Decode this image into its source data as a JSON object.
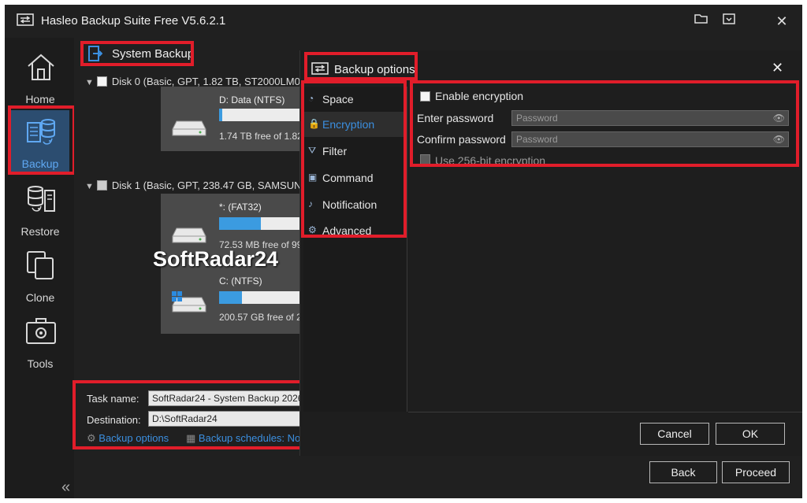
{
  "app": {
    "title": "Hasleo Backup Suite Free V5.6.2.1"
  },
  "titlebar": {
    "folder_icon": "folder-open-icon",
    "menu_icon": "menu-icon",
    "close": "✕"
  },
  "sidenav": {
    "items": [
      {
        "label": "Home",
        "icon": "home-icon"
      },
      {
        "label": "Backup",
        "icon": "backup-icon",
        "active": true
      },
      {
        "label": "Restore",
        "icon": "restore-icon"
      },
      {
        "label": "Clone",
        "icon": "clone-icon"
      },
      {
        "label": "Tools",
        "icon": "tools-icon"
      }
    ],
    "collapse": "«"
  },
  "main": {
    "title": "System Backup",
    "disks": [
      {
        "label": "Disk 0 (Basic, GPT, 1.82 TB,  ST2000LM0",
        "partitions": [
          {
            "name": "D: Data (NTFS)",
            "free": "1.74 TB free of 1.82",
            "used_fraction": 0.04
          }
        ]
      },
      {
        "label": "Disk 1 (Basic, GPT, 238.47 GB,  SAMSUN",
        "partitions": [
          {
            "name": "*: (FAT32)",
            "free": "72.53 MB free of 99",
            "used_fraction": 0.49
          },
          {
            "name": "C: (NTFS)",
            "free": "200.57 GB free of 23",
            "used_fraction": 0.27
          }
        ]
      }
    ],
    "watermark": "SoftRadar24",
    "task_name_label": "Task name:",
    "task_name_value": "SoftRadar24 - System Backup 2026",
    "destination_label": "Destination:",
    "destination_value": "D:\\SoftRadar24",
    "backup_options_link": "Backup options",
    "backup_schedules_link": "Backup schedules: No"
  },
  "dialog": {
    "title": "Backup options",
    "close": "✕",
    "options": [
      {
        "label": "Space",
        "icon": "pie-chart-icon"
      },
      {
        "label": "Encryption",
        "icon": "lock-icon",
        "active": true
      },
      {
        "label": "Filter",
        "icon": "filter-icon"
      },
      {
        "label": "Command",
        "icon": "terminal-icon"
      },
      {
        "label": "Notification",
        "icon": "bell-icon"
      },
      {
        "label": "Advanced",
        "icon": "gear-icon"
      }
    ],
    "encryption": {
      "enable_label": "Enable encryption",
      "enter_password_label": "Enter password",
      "enter_password_placeholder": "Password",
      "confirm_password_label": "Confirm password",
      "confirm_password_placeholder": "Password",
      "use_256_label": "Use 256-bit encryption"
    },
    "cancel": "Cancel",
    "ok": "OK"
  },
  "footer": {
    "back": "Back",
    "proceed": "Proceed"
  },
  "colors": {
    "accent": "#3b8fe0",
    "highlight": "#e11d2a",
    "bar_fill": "#3b9be0"
  }
}
